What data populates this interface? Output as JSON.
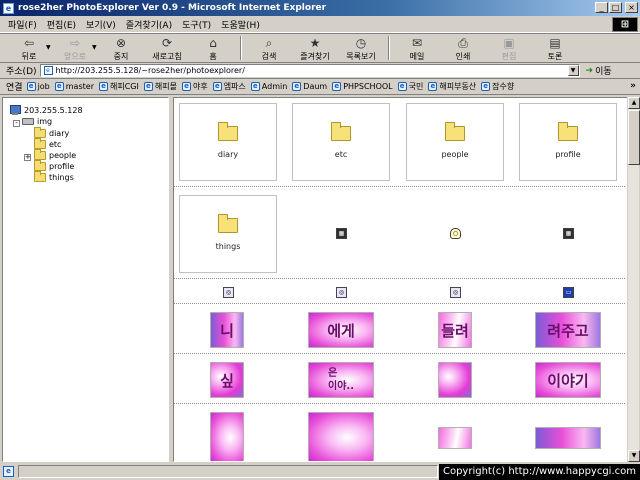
{
  "window": {
    "title": "rose2her PhotoExplorer Ver 0.9 - Microsoft Internet Explorer",
    "app_icon": "ie-icon",
    "buttons": [
      "_",
      "□",
      "×"
    ]
  },
  "menu": [
    "파일(F)",
    "편집(E)",
    "보기(V)",
    "즐겨찾기(A)",
    "도구(T)",
    "도움말(H)"
  ],
  "toolbar": [
    {
      "label": "뒤로",
      "icon": "back-arrow-icon",
      "glyph": "⇦",
      "enabled": true
    },
    {
      "label": "앞으로",
      "icon": "forward-arrow-icon",
      "glyph": "⇨",
      "enabled": false
    },
    {
      "label": "중지",
      "icon": "stop-icon",
      "glyph": "⊗",
      "enabled": true
    },
    {
      "label": "새로고침",
      "icon": "refresh-icon",
      "glyph": "⟳",
      "enabled": true
    },
    {
      "label": "홈",
      "icon": "home-icon",
      "glyph": "⌂",
      "enabled": true
    },
    {
      "label": "검색",
      "icon": "search-icon",
      "glyph": "⌕",
      "enabled": true
    },
    {
      "label": "즐겨찾기",
      "icon": "favorites-icon",
      "glyph": "★",
      "enabled": true
    },
    {
      "label": "목록보기",
      "icon": "history-icon",
      "glyph": "◷",
      "enabled": true
    },
    {
      "label": "메일",
      "icon": "mail-icon",
      "glyph": "✉",
      "enabled": true
    },
    {
      "label": "인쇄",
      "icon": "print-icon",
      "glyph": "⎙",
      "enabled": true
    },
    {
      "label": "편집",
      "icon": "edit-icon",
      "glyph": "▣",
      "enabled": false
    },
    {
      "label": "토론",
      "icon": "discuss-icon",
      "glyph": "▤",
      "enabled": true
    }
  ],
  "address": {
    "label": "주소(D)",
    "value": "http://203.255.5.128/~rose2her/photoexplorer/",
    "go_label": "이동"
  },
  "links": {
    "label": "연결",
    "items": [
      "job",
      "master",
      "해피CGI",
      "해피몰",
      "야후",
      "엠파스",
      "Admin",
      "Daum",
      "PHPSCHOOL",
      "국민",
      "해피부동산",
      "잡수향"
    ]
  },
  "tree": {
    "root": "203.255.5.128",
    "drive": "img",
    "folders": [
      "diary",
      "etc",
      "people",
      "profile",
      "things"
    ]
  },
  "content": {
    "folders": [
      "diary",
      "etc",
      "people",
      "profile",
      "things"
    ],
    "thumb_texts": [
      "니",
      "에게",
      "들려",
      "려주고",
      "싶",
      "은\n이야..",
      "",
      "이야기",
      "",
      "",
      "",
      ""
    ]
  },
  "status": {
    "copyright": "Copyright(c) http://www.happycgi.com"
  }
}
